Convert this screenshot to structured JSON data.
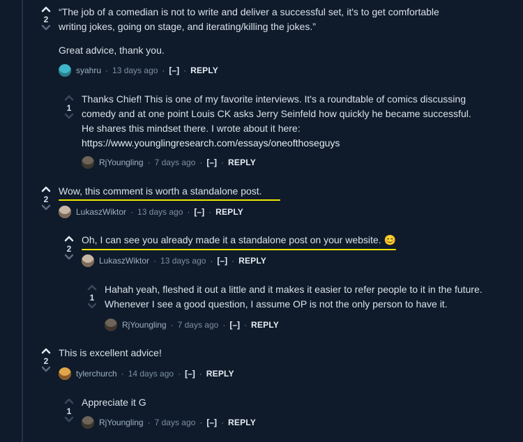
{
  "comments": [
    {
      "votes": "2",
      "text1": "“The job of a comedian is not to write and deliver a successful set, it's to get comfortable",
      "text2": "writing jokes, going on stage, and iterating/killing the jokes.”",
      "text3": "Great advice, thank you.",
      "author": "syahru",
      "time": "13 days ago",
      "collapse": "[–]",
      "reply": "REPLY"
    },
    {
      "votes": "1",
      "text1": "Thanks Chief! This is one of my favorite interviews. It's a roundtable of comics discussing",
      "text2": "comedy and at one point Louis CK asks Jerry Seinfeld how quickly he became successful.",
      "text3": "He shares this mindset there. I wrote about it here:",
      "link": "https://www.younglingresearch.com/essays/oneofthoseguys",
      "author": "RjYoungling",
      "time": "7 days ago",
      "collapse": "[–]",
      "reply": "REPLY"
    },
    {
      "votes": "2",
      "text1": "Wow, this comment is worth a standalone post.",
      "author": "LukaszWiktor",
      "time": "13 days ago",
      "collapse": "[–]",
      "reply": "REPLY"
    },
    {
      "votes": "2",
      "text1": "Oh, I can see you already made it a standalone post on your website. 😊",
      "author": "LukaszWiktor",
      "time": "13 days ago",
      "collapse": "[–]",
      "reply": "REPLY"
    },
    {
      "votes": "1",
      "text1": "Hahah yeah, fleshed it out a little and it makes it easier to refer people to it in the future.",
      "text2": "Whenever I see a good question, I assume OP is not the only person to have it.",
      "author": "RjYoungling",
      "time": "7 days ago",
      "collapse": "[–]",
      "reply": "REPLY"
    },
    {
      "votes": "2",
      "text1": "This is excellent advice!",
      "author": "tylerchurch",
      "time": "14 days ago",
      "collapse": "[–]",
      "reply": "REPLY"
    },
    {
      "votes": "1",
      "text1": "Appreciate it G",
      "author": "RjYoungling",
      "time": "7 days ago",
      "collapse": "[–]",
      "reply": "REPLY"
    }
  ],
  "colors": {
    "background": "#0f1b2a",
    "highlight_underline": "#f2e600",
    "text": "#d9e1ea"
  },
  "icons": [
    "upvote-icon",
    "downvote-icon",
    "avatar"
  ]
}
